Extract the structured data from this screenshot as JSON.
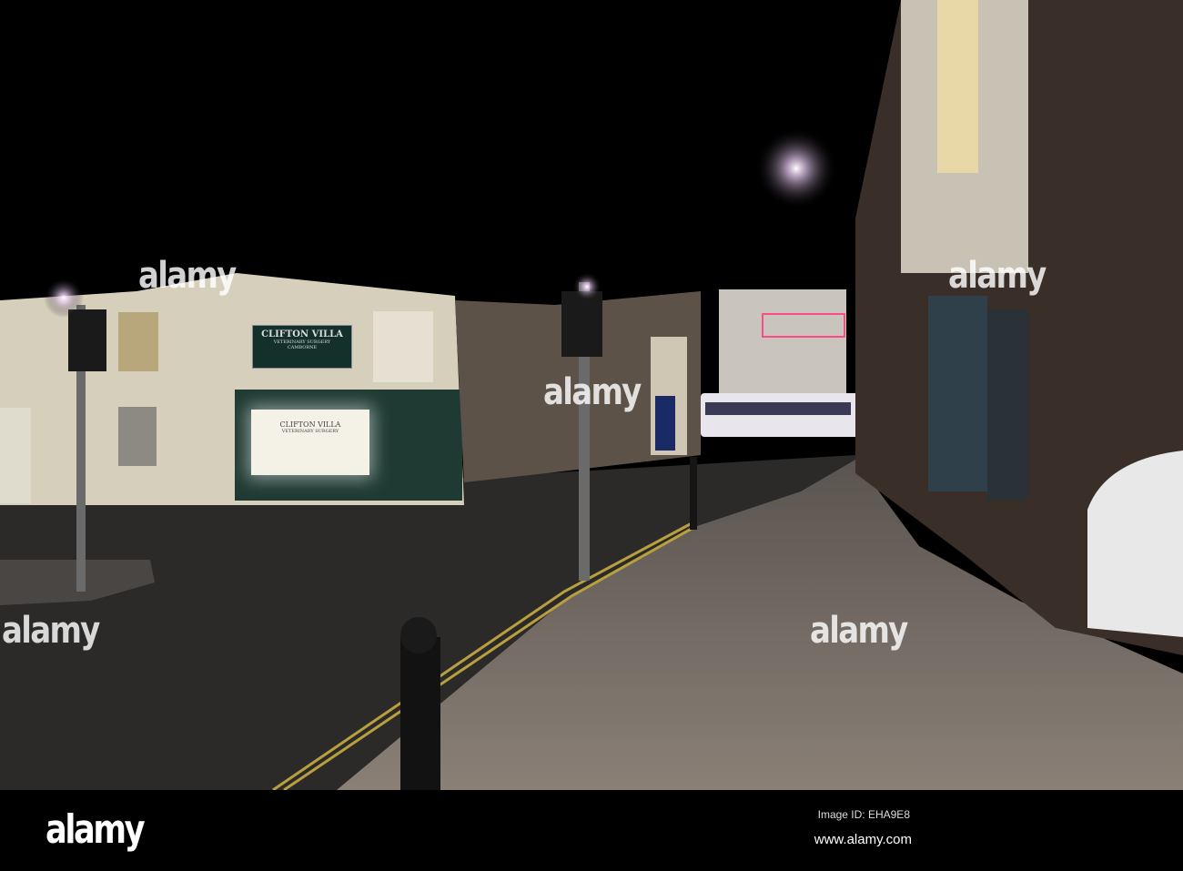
{
  "watermark": {
    "text": "alamy"
  },
  "shop": {
    "sign_title": "CLIFTON VILLA",
    "sign_subtitle": "VETERINARY SURGERY",
    "sign_location": "CAMBORNE",
    "window_title": "CLIFTON VILLA",
    "window_subtitle": "VETERINARY SURGERY"
  },
  "footer": {
    "logo": "alamy",
    "image_id": "Image ID: EHA9E8",
    "url": "www.alamy.com"
  },
  "colors": {
    "sky": "#000000",
    "building": "#d8d2c0",
    "road": "#2b2a29",
    "pavement": "#7a7168",
    "brick": "#3a2e28"
  }
}
